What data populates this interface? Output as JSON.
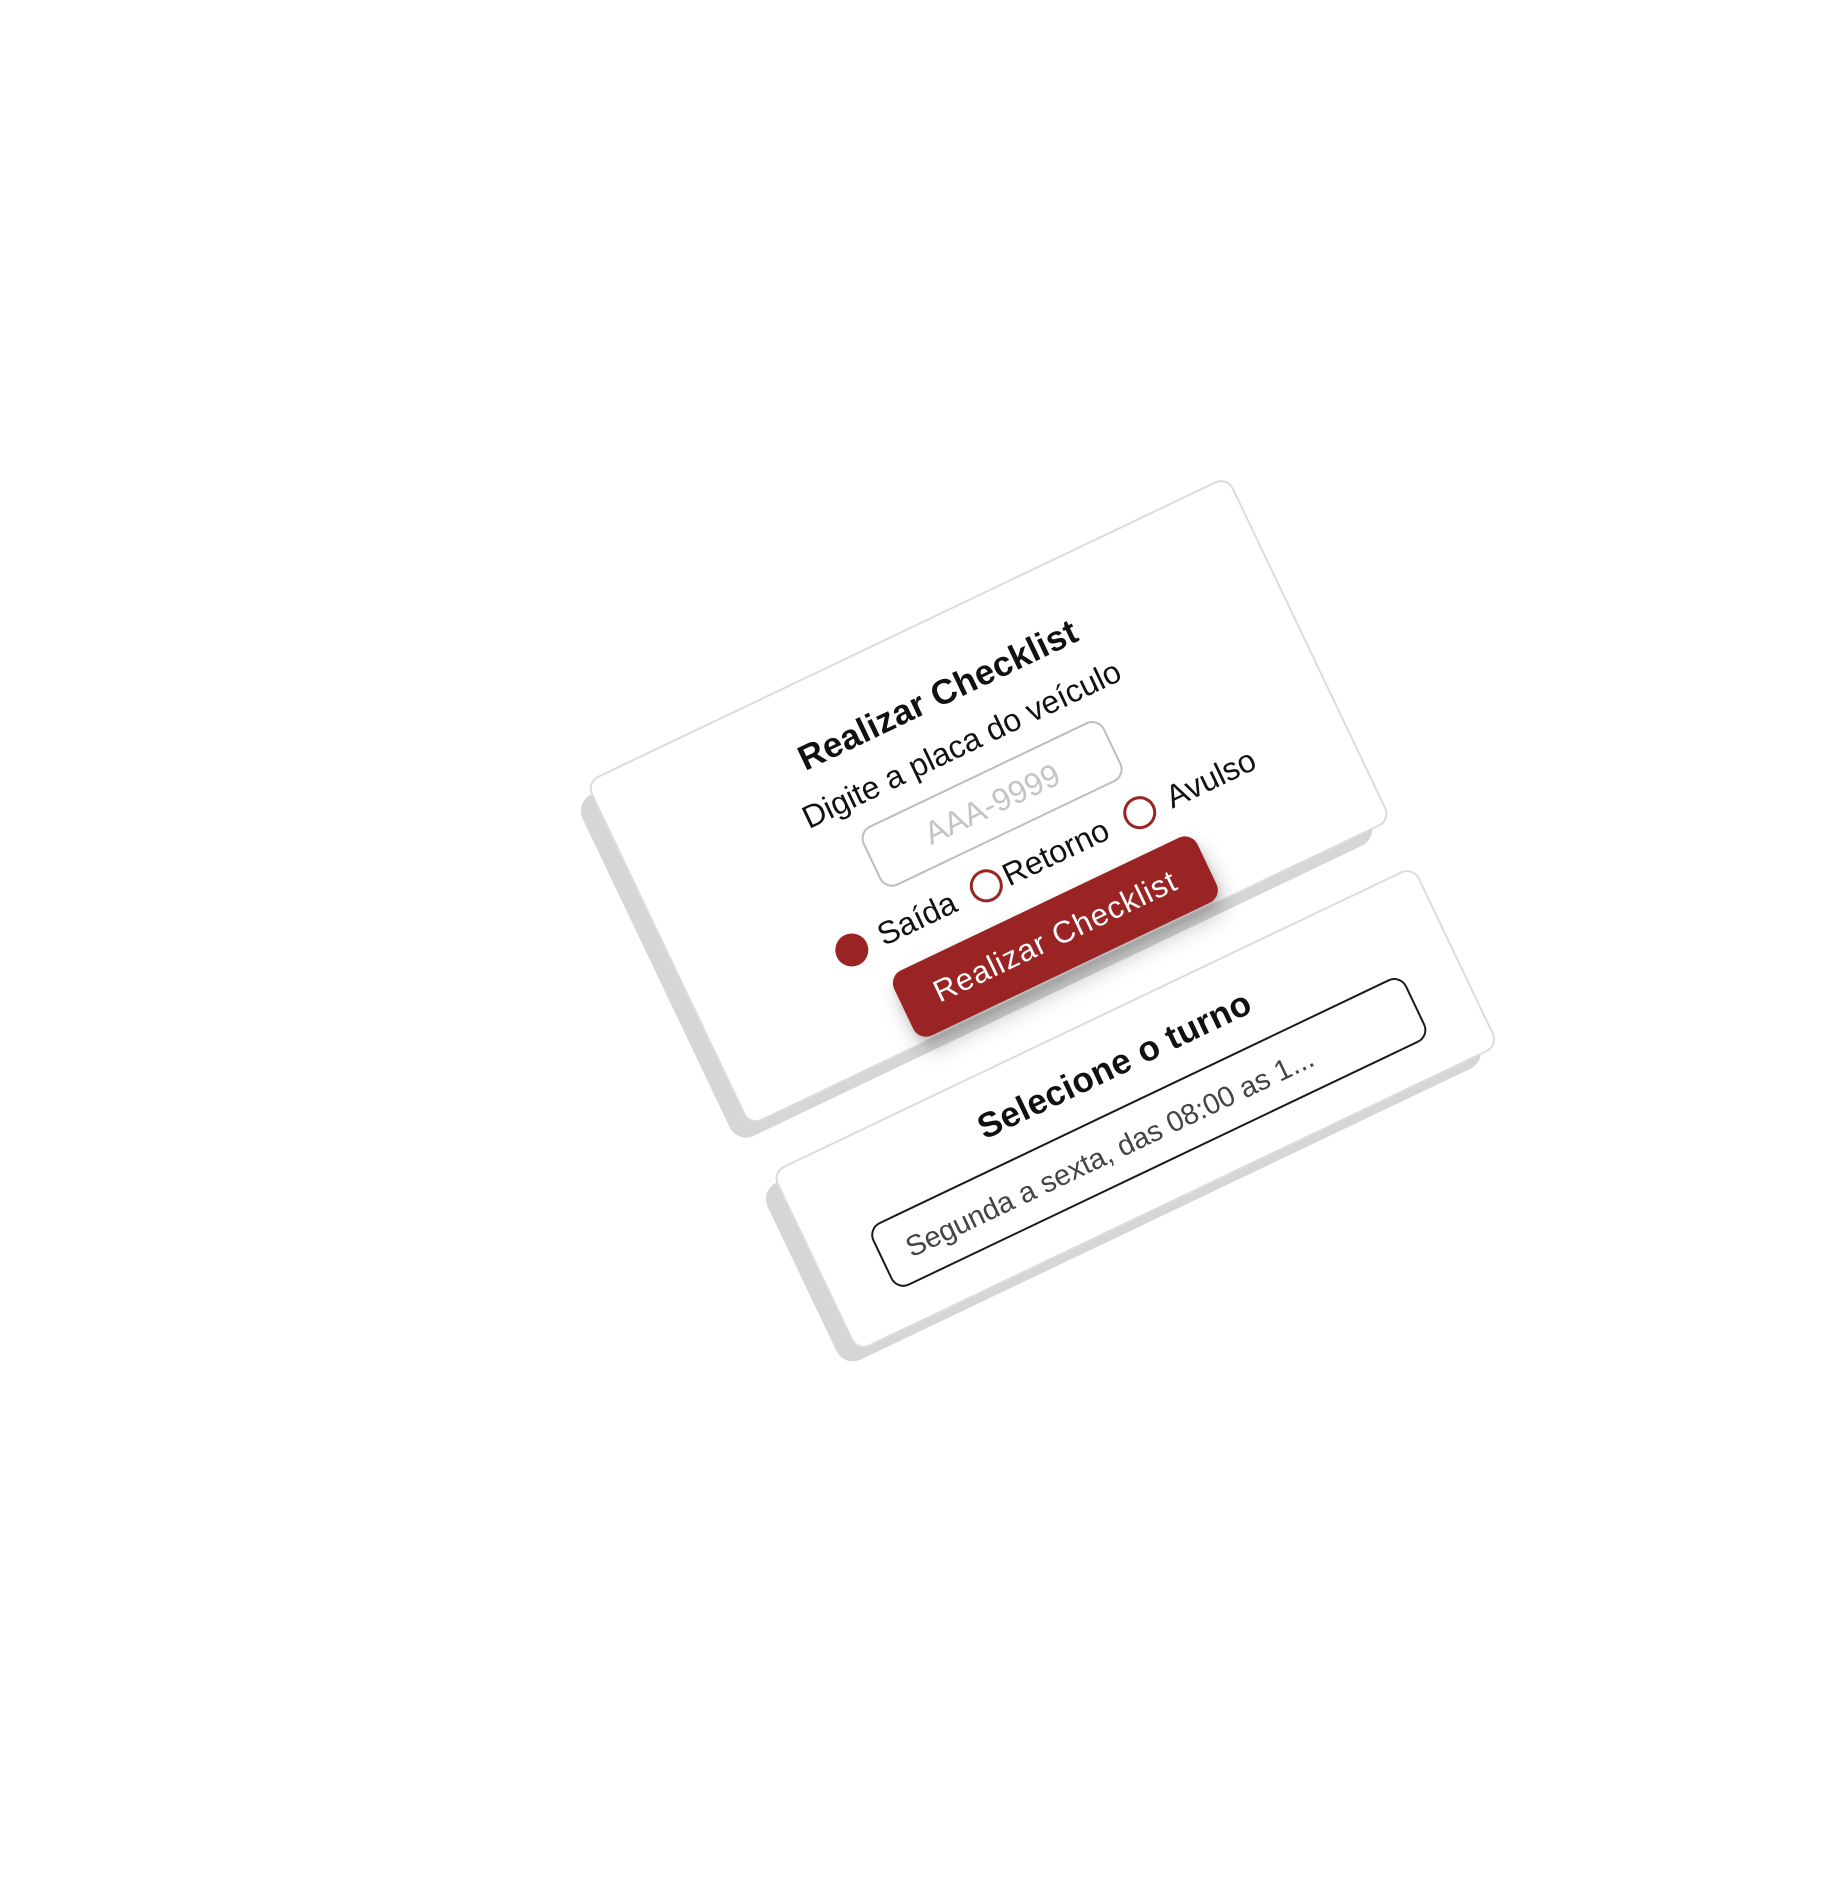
{
  "checklist_card": {
    "title": "Realizar Checklist",
    "plate_label": "Digite a placa do veículo",
    "plate_input": {
      "value": "",
      "placeholder": "AAA-9999"
    },
    "trip_type": {
      "options": [
        {
          "label": "Saída",
          "selected": true
        },
        {
          "label": "Retorno",
          "selected": false
        },
        {
          "label": "Avulso",
          "selected": false
        }
      ]
    },
    "submit_label": "Realizar Checklist"
  },
  "shift_card": {
    "title": "Selecione o turno",
    "selected_shift": "Segunda a sexta, das 08:00 as 1..."
  },
  "colors": {
    "accent": "#9a2424",
    "card_border": "#dcdcdc",
    "card_depth": "#d6d6d6"
  }
}
